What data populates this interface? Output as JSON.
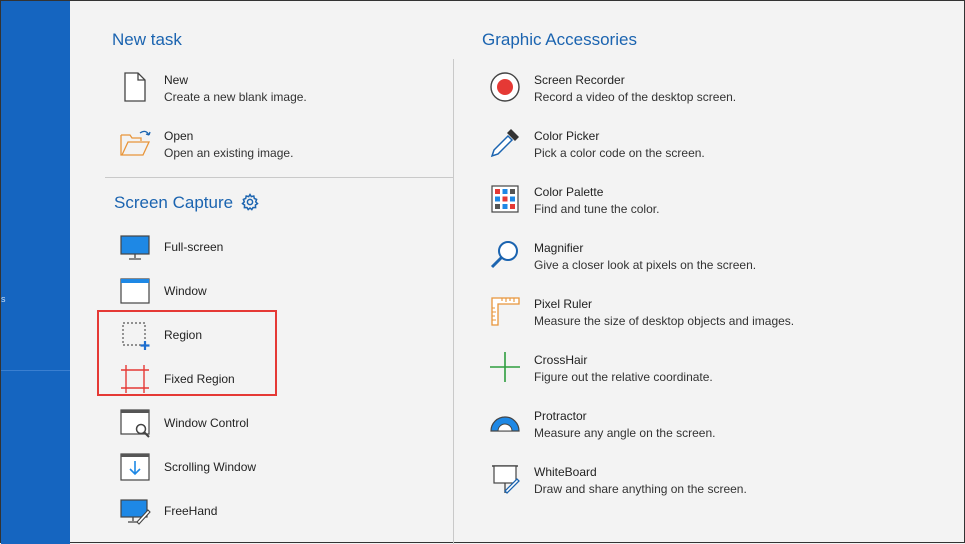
{
  "new_task": {
    "title": "New task",
    "items": [
      {
        "name": "New",
        "desc": "Create a new blank image.",
        "icon": "new-file-icon"
      },
      {
        "name": "Open",
        "desc": "Open an existing image.",
        "icon": "open-folder-icon"
      }
    ]
  },
  "screen_capture": {
    "title": "Screen Capture",
    "settings_icon": "gear-icon",
    "items": [
      {
        "name": "Full-screen",
        "icon": "monitor-icon"
      },
      {
        "name": "Window",
        "icon": "window-icon"
      },
      {
        "name": "Region",
        "icon": "region-icon"
      },
      {
        "name": "Fixed Region",
        "icon": "fixed-region-icon"
      },
      {
        "name": "Window Control",
        "icon": "window-control-icon"
      },
      {
        "name": "Scrolling Window",
        "icon": "scrolling-window-icon"
      },
      {
        "name": "FreeHand",
        "icon": "freehand-icon"
      }
    ]
  },
  "graphic_accessories": {
    "title": "Graphic Accessories",
    "items": [
      {
        "name": "Screen Recorder",
        "desc": "Record a video of the desktop screen.",
        "icon": "record-icon"
      },
      {
        "name": "Color Picker",
        "desc": "Pick a color code on the screen.",
        "icon": "eyedropper-icon"
      },
      {
        "name": "Color Palette",
        "desc": "Find and tune the color.",
        "icon": "palette-icon"
      },
      {
        "name": "Magnifier",
        "desc": "Give a closer look at pixels on the screen.",
        "icon": "magnifier-icon"
      },
      {
        "name": "Pixel Ruler",
        "desc": "Measure the size of desktop objects and images.",
        "icon": "ruler-icon"
      },
      {
        "name": "CrossHair",
        "desc": "Figure out the relative coordinate.",
        "icon": "crosshair-icon"
      },
      {
        "name": "Protractor",
        "desc": "Measure any angle on the screen.",
        "icon": "protractor-icon"
      },
      {
        "name": "WhiteBoard",
        "desc": "Draw and share anything on the screen.",
        "icon": "whiteboard-icon"
      }
    ]
  },
  "colors": {
    "sidebar": "#1565c0",
    "accent": "#1b64b0",
    "highlight": "#e53935",
    "record": "#e53935"
  }
}
